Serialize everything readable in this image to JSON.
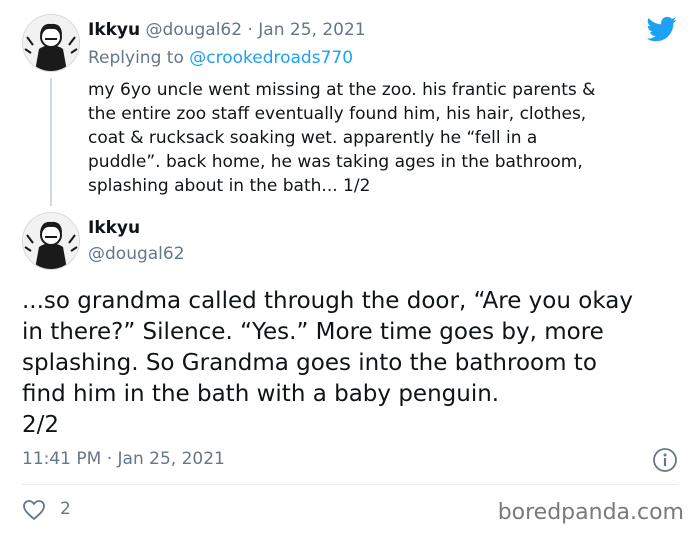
{
  "reply": {
    "name": "Ikkyu",
    "handle": "@dougal62",
    "separator": "·",
    "date": "Jan 25, 2021",
    "replying_prefix": "Replying to",
    "replying_to": "@crookedroads770",
    "lines": [
      "my 6yo uncle went missing at the zoo. his frantic parents &",
      "the entire zoo staff eventually found him, his hair, clothes,",
      "coat & rucksack soaking wet. apparently he “fell in a",
      "puddle”. back home, he was taking ages in the bathroom,",
      "splashing about in the bath... 1/2"
    ]
  },
  "main": {
    "name": "Ikkyu",
    "handle": "@dougal62",
    "lines": [
      "...so grandma called through the door, “Are you okay",
      "in there?” Silence. “Yes.” More time goes by, more",
      "splashing. So Grandma goes into the bathroom to",
      "find him in the bath with a baby penguin.",
      "2/2"
    ],
    "timestamp": "11:41 PM · Jan 25, 2021"
  },
  "actions": {
    "likes": "2"
  },
  "watermark": "boredpanda.com",
  "colors": {
    "twitter_blue": "#1da1f2",
    "muted": "#657786",
    "text": "#0f1419"
  }
}
